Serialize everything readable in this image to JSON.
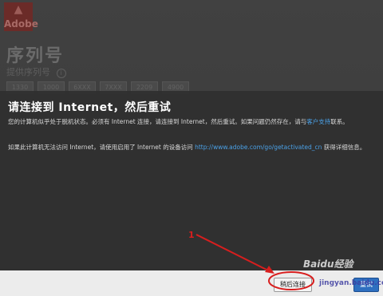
{
  "background": {
    "logo_text": "Adobe",
    "title": "序列号",
    "subtitle": "提供序列号",
    "serial_segments": [
      "1330",
      "1000",
      "6XXX",
      "7XXX",
      "2209",
      "4900"
    ]
  },
  "dialog": {
    "title": "请连接到 Internet，然后重试",
    "message1_part1": "您的计算机似乎处于脱机状态。必须有 Internet 连接，请连接到 Internet，然后重试。如果问题仍然存在，请与",
    "message1_link": "客户支持",
    "message1_part2": "联系。",
    "message2_part1": "如果此计算机无法访问 Internet，请使用启用了 Internet 的设备访问 ",
    "message2_link": "http://www.adobe.com/go/getactivated_cn",
    "message2_part2": " 获得详细信息。"
  },
  "buttons": {
    "later_label": "稍后连接",
    "retry_label": "重试"
  },
  "annotation": {
    "step_number": "1"
  },
  "watermark": {
    "text": "Baidu经验",
    "sub": "jingyan.baidu.com"
  },
  "colors": {
    "accent_link": "#4aa0e6",
    "primary_button": "#2e6fc0",
    "annotation_red": "#d81e1e"
  }
}
